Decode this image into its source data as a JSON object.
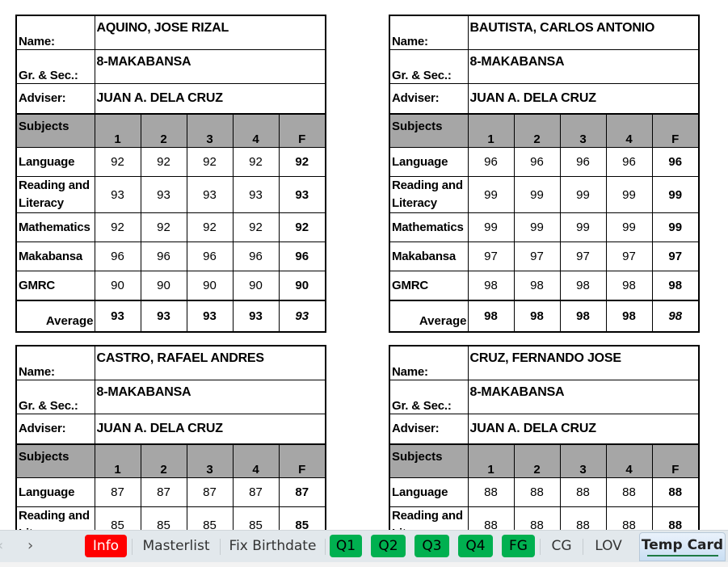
{
  "labels": {
    "name": "Name:",
    "grade_section": "Gr. & Sec.:",
    "adviser": "Adviser:",
    "subjects": "Subjects",
    "quarters": [
      "1",
      "2",
      "3",
      "4",
      "F"
    ],
    "average": "Average"
  },
  "cards": [
    {
      "name": "AQUINO, JOSE RIZAL",
      "grade_section": "8-MAKABANSA",
      "adviser": "JUAN A. DELA CRUZ",
      "subjects": [
        {
          "name": "Language",
          "grades": [
            "92",
            "92",
            "92",
            "92"
          ],
          "final": "92"
        },
        {
          "name": "Reading and Literacy",
          "grades": [
            "93",
            "93",
            "93",
            "93"
          ],
          "final": "93"
        },
        {
          "name": "Mathematics",
          "grades": [
            "92",
            "92",
            "92",
            "92"
          ],
          "final": "92"
        },
        {
          "name": "Makabansa",
          "grades": [
            "96",
            "96",
            "96",
            "96"
          ],
          "final": "96"
        },
        {
          "name": "GMRC",
          "grades": [
            "90",
            "90",
            "90",
            "90"
          ],
          "final": "90"
        }
      ],
      "average": [
        "93",
        "93",
        "93",
        "93"
      ],
      "average_final": "93"
    },
    {
      "name": "BAUTISTA, CARLOS ANTONIO",
      "grade_section": "8-MAKABANSA",
      "adviser": "JUAN A. DELA CRUZ",
      "subjects": [
        {
          "name": "Language",
          "grades": [
            "96",
            "96",
            "96",
            "96"
          ],
          "final": "96"
        },
        {
          "name": "Reading and Literacy",
          "grades": [
            "99",
            "99",
            "99",
            "99"
          ],
          "final": "99"
        },
        {
          "name": "Mathematics",
          "grades": [
            "99",
            "99",
            "99",
            "99"
          ],
          "final": "99"
        },
        {
          "name": "Makabansa",
          "grades": [
            "97",
            "97",
            "97",
            "97"
          ],
          "final": "97"
        },
        {
          "name": "GMRC",
          "grades": [
            "98",
            "98",
            "98",
            "98"
          ],
          "final": "98"
        }
      ],
      "average": [
        "98",
        "98",
        "98",
        "98"
      ],
      "average_final": "98"
    },
    {
      "name": "CASTRO, RAFAEL ANDRES",
      "grade_section": "8-MAKABANSA",
      "adviser": "JUAN A. DELA CRUZ",
      "subjects": [
        {
          "name": "Language",
          "grades": [
            "87",
            "87",
            "87",
            "87"
          ],
          "final": "87"
        },
        {
          "name": "Reading and Literacy",
          "grades": [
            "85",
            "85",
            "85",
            "85"
          ],
          "final": "85"
        }
      ]
    },
    {
      "name": "CRUZ, FERNANDO JOSE",
      "grade_section": "8-MAKABANSA",
      "adviser": "JUAN A. DELA CRUZ",
      "subjects": [
        {
          "name": "Language",
          "grades": [
            "88",
            "88",
            "88",
            "88"
          ],
          "final": "88"
        },
        {
          "name": "Reading and Literacy",
          "grades": [
            "88",
            "88",
            "88",
            "88"
          ],
          "final": "88"
        }
      ]
    }
  ],
  "sheet_tabs": {
    "prev_icon": "‹",
    "next_icon": "›",
    "tabs": [
      {
        "label": "Info",
        "color": "#ff0000"
      },
      {
        "label": "Masterlist"
      },
      {
        "label": "Fix Birthdate"
      },
      {
        "label": "Q1",
        "color": "#00b050"
      },
      {
        "label": "Q2",
        "color": "#00b050"
      },
      {
        "label": "Q3",
        "color": "#00b050"
      },
      {
        "label": "Q4",
        "color": "#00b050"
      },
      {
        "label": "FG",
        "color": "#00b050"
      },
      {
        "label": "CG"
      },
      {
        "label": "LOV"
      },
      {
        "label": "Temp Card",
        "active": true
      }
    ]
  }
}
